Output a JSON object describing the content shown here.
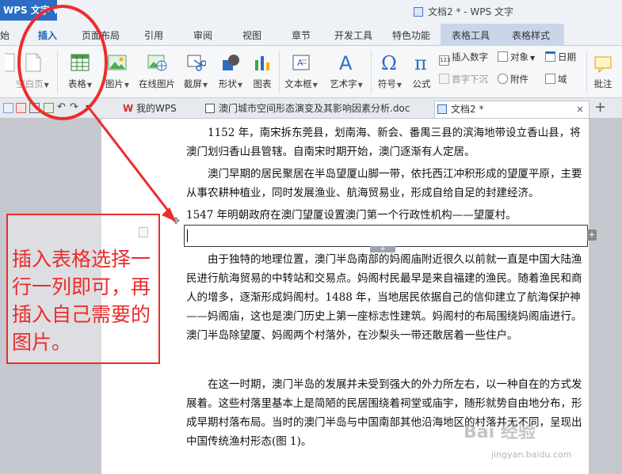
{
  "app": {
    "badge": "WPS 文字",
    "doc_title": "文档2 * - WPS 文字"
  },
  "menu": {
    "tabs": [
      "始",
      "插入",
      "页面布局",
      "引用",
      "审阅",
      "视图",
      "章节",
      "开发工具",
      "特色功能",
      "表格工具",
      "表格样式"
    ],
    "active": "插入"
  },
  "ribbon": {
    "cover_page": "封面页",
    "blank_page": "空白页",
    "table": "表格",
    "picture": "图片",
    "online_picture": "在线图片",
    "screenshot": "截屏",
    "shapes": "形状",
    "chart": "图表",
    "textbox": "文本框",
    "wordart": "艺术字",
    "symbol": "符号",
    "formula": "公式",
    "insert_number": "插入数字",
    "dropcap": "首字下沉",
    "object": "对象",
    "attachment": "附件",
    "date": "日期",
    "field": "域",
    "comment": "批注",
    "pi_symbol": "π",
    "omega_symbol": "Ω",
    "a_symbol": "A"
  },
  "doctabs": {
    "my_wps": "我的WPS",
    "doc1": "澳门城市空间形态演变及其影响因素分析.doc",
    "doc2": "文档2 *",
    "close": "×",
    "new_tab": "+"
  },
  "document": {
    "p1": "1152 年，南宋拆东莞县，划南海、新会、番禺三县的滨海地带设立香山县，将澳门划归香山县管辖。自南宋时期开始，澳门逐渐有人定居。",
    "p2": "澳门早期的居民聚居在半岛望厦山脚一带，依托西江冲积形成的望厦平原，主要从事农耕种植业，同时发展渔业、航海贸易业，形成自给自足的封建经济。",
    "p3": "1547 年明朝政府在澳门望厦设置澳门第一个行政性机构——望厦村。",
    "p4": "由于独特的地理位置，澳门半岛南部的妈阁庙附近很久以前就一直是中国大陆渔民进行航海贸易的中转站和交易点。妈阁村民最早是来自福建的渔民。随着渔民和商人的增多，逐渐形成妈阁村。1488 年，当地居民依据自己的信仰建立了航海保护神——妈阁庙，这也是澳门历史上第一座标志性建筑。妈阁村的布局围绕妈阁庙进行。澳门半岛除望厦、妈阁两个村落外，在沙梨头一带还散居着一些住户。",
    "p5": "在这一时期，澳门半岛的发展并未受到强大的外力所左右，以一种自在的方式发展着。这些村落里基本上是简陋的民居围绕着祠堂或庙宇，随形就势自由地分布，形成早期村落布局。当时的澳门半岛与中国南部其他沿海地区的村落并无不同，呈现出中国传统渔村形态(图 1)。"
  },
  "annotation": {
    "callout": "插入表格选择一行一列即可，再插入自己需要的图片。"
  },
  "watermark": {
    "main": "Bai 经验",
    "sub": "jingyan.baidu.com"
  },
  "colors": {
    "accent": "#2c6cc2",
    "annotation": "#ee2b2b"
  }
}
